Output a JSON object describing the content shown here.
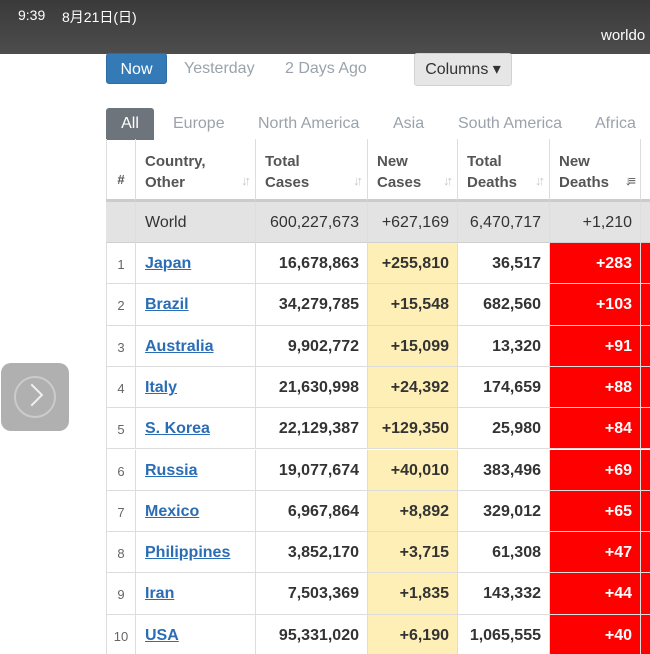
{
  "status_bar": {
    "time": "9:39",
    "date": "8月21日(日)",
    "url_fragment": "worldo"
  },
  "period_buttons": {
    "now": "Now",
    "yesterday": "Yesterday",
    "two_days_ago": "2 Days Ago",
    "columns": "Columns ▾"
  },
  "tabs": {
    "all": "All",
    "europe": "Europe",
    "north_america": "North America",
    "asia": "Asia",
    "south_america": "South America",
    "africa": "Africa"
  },
  "table": {
    "headers": {
      "hash": "#",
      "country_line1": "Country,",
      "country_line2": "Other",
      "total_cases_line1": "Total",
      "total_cases_line2": "Cases",
      "new_cases_line1": "New",
      "new_cases_line2": "Cases",
      "total_deaths_line1": "Total",
      "total_deaths_line2": "Deaths",
      "new_deaths_line1": "New",
      "new_deaths_line2": "Deaths"
    },
    "world": {
      "name": "World",
      "total_cases": "600,227,673",
      "new_cases": "+627,169",
      "total_deaths": "6,470,717",
      "new_deaths": "+1,210"
    },
    "rows": [
      {
        "rank": "1",
        "country": "Japan",
        "total_cases": "16,678,863",
        "new_cases": "+255,810",
        "total_deaths": "36,517",
        "new_deaths": "+283"
      },
      {
        "rank": "2",
        "country": "Brazil",
        "total_cases": "34,279,785",
        "new_cases": "+15,548",
        "total_deaths": "682,560",
        "new_deaths": "+103"
      },
      {
        "rank": "3",
        "country": "Australia",
        "total_cases": "9,902,772",
        "new_cases": "+15,099",
        "total_deaths": "13,320",
        "new_deaths": "+91"
      },
      {
        "rank": "4",
        "country": "Italy",
        "total_cases": "21,630,998",
        "new_cases": "+24,392",
        "total_deaths": "174,659",
        "new_deaths": "+88"
      },
      {
        "rank": "5",
        "country": "S. Korea",
        "total_cases": "22,129,387",
        "new_cases": "+129,350",
        "total_deaths": "25,980",
        "new_deaths": "+84"
      },
      {
        "rank": "6",
        "country": "Russia",
        "total_cases": "19,077,674",
        "new_cases": "+40,010",
        "total_deaths": "383,496",
        "new_deaths": "+69"
      },
      {
        "rank": "7",
        "country": "Mexico",
        "total_cases": "6,967,864",
        "new_cases": "+8,892",
        "total_deaths": "329,012",
        "new_deaths": "+65"
      },
      {
        "rank": "8",
        "country": "Philippines",
        "total_cases": "3,852,170",
        "new_cases": "+3,715",
        "total_deaths": "61,308",
        "new_deaths": "+47"
      },
      {
        "rank": "9",
        "country": "Iran",
        "total_cases": "7,503,369",
        "new_cases": "+1,835",
        "total_deaths": "143,332",
        "new_deaths": "+44"
      },
      {
        "rank": "10",
        "country": "USA",
        "total_cases": "95,331,020",
        "new_cases": "+6,190",
        "total_deaths": "1,065,555",
        "new_deaths": "+40"
      }
    ]
  },
  "colors": {
    "now_button": "#337ab7",
    "all_tab": "#6d747b",
    "new_cases_bg": "#fdefb5",
    "new_deaths_bg": "#ff0000",
    "link": "#2a6db5"
  },
  "icons": {
    "side_button": "chevron-right-icon"
  }
}
